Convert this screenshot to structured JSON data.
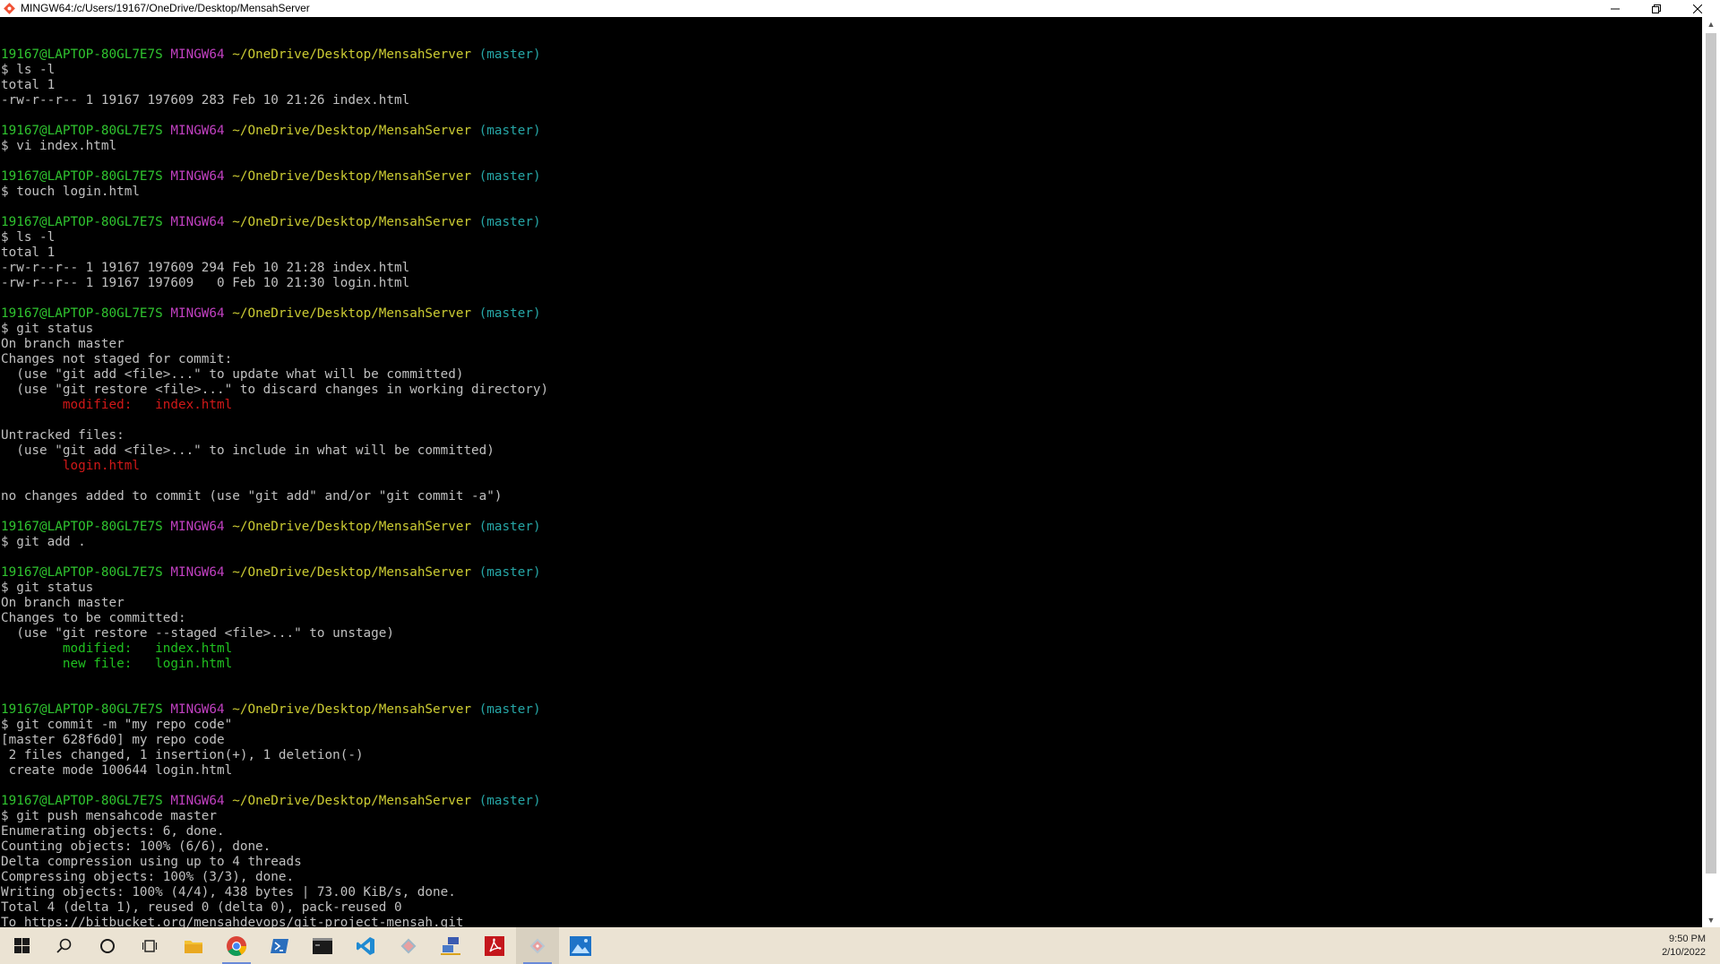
{
  "window": {
    "title": "MINGW64:/c/Users/19167/OneDrive/Desktop/MensahServer",
    "buttons": {
      "minimize": "minimize-icon",
      "restore": "restore-icon",
      "close": "close-icon"
    }
  },
  "colors": {
    "user_host": "#2fc42f",
    "shell": "#c040c0",
    "path": "#cccc33",
    "branch": "#26a6a6",
    "unstaged": "#d01818",
    "staged": "#20c020",
    "text": "#c0c0c0",
    "background": "#000000",
    "taskbar": "#ebe3d3"
  },
  "terminal": {
    "lines": [
      [],
      [
        {
          "t": "19167@LAPTOP-80GL7E7S",
          "c": "green"
        },
        {
          "t": " "
        },
        {
          "t": "MINGW64",
          "c": "magenta"
        },
        {
          "t": " "
        },
        {
          "t": "~/OneDrive/Desktop/MensahServer",
          "c": "yellow"
        },
        {
          "t": " "
        },
        {
          "t": "(master)",
          "c": "cyan"
        }
      ],
      [
        {
          "t": "$ ls -l"
        }
      ],
      [
        {
          "t": "total 1"
        }
      ],
      [
        {
          "t": "-rw-r--r-- 1 19167 197609 283 Feb 10 21:26 index.html"
        }
      ],
      [],
      [
        {
          "t": "19167@LAPTOP-80GL7E7S",
          "c": "green"
        },
        {
          "t": " "
        },
        {
          "t": "MINGW64",
          "c": "magenta"
        },
        {
          "t": " "
        },
        {
          "t": "~/OneDrive/Desktop/MensahServer",
          "c": "yellow"
        },
        {
          "t": " "
        },
        {
          "t": "(master)",
          "c": "cyan"
        }
      ],
      [
        {
          "t": "$ vi index.html"
        }
      ],
      [],
      [
        {
          "t": "19167@LAPTOP-80GL7E7S",
          "c": "green"
        },
        {
          "t": " "
        },
        {
          "t": "MINGW64",
          "c": "magenta"
        },
        {
          "t": " "
        },
        {
          "t": "~/OneDrive/Desktop/MensahServer",
          "c": "yellow"
        },
        {
          "t": " "
        },
        {
          "t": "(master)",
          "c": "cyan"
        }
      ],
      [
        {
          "t": "$ touch login.html"
        }
      ],
      [],
      [
        {
          "t": "19167@LAPTOP-80GL7E7S",
          "c": "green"
        },
        {
          "t": " "
        },
        {
          "t": "MINGW64",
          "c": "magenta"
        },
        {
          "t": " "
        },
        {
          "t": "~/OneDrive/Desktop/MensahServer",
          "c": "yellow"
        },
        {
          "t": " "
        },
        {
          "t": "(master)",
          "c": "cyan"
        }
      ],
      [
        {
          "t": "$ ls -l"
        }
      ],
      [
        {
          "t": "total 1"
        }
      ],
      [
        {
          "t": "-rw-r--r-- 1 19167 197609 294 Feb 10 21:28 index.html"
        }
      ],
      [
        {
          "t": "-rw-r--r-- 1 19167 197609   0 Feb 10 21:30 login.html"
        }
      ],
      [],
      [
        {
          "t": "19167@LAPTOP-80GL7E7S",
          "c": "green"
        },
        {
          "t": " "
        },
        {
          "t": "MINGW64",
          "c": "magenta"
        },
        {
          "t": " "
        },
        {
          "t": "~/OneDrive/Desktop/MensahServer",
          "c": "yellow"
        },
        {
          "t": " "
        },
        {
          "t": "(master)",
          "c": "cyan"
        }
      ],
      [
        {
          "t": "$ git status"
        }
      ],
      [
        {
          "t": "On branch master"
        }
      ],
      [
        {
          "t": "Changes not staged for commit:"
        }
      ],
      [
        {
          "t": "  (use \"git add <file>...\" to update what will be committed)"
        }
      ],
      [
        {
          "t": "  (use \"git restore <file>...\" to discard changes in working directory)"
        }
      ],
      [
        {
          "t": "        "
        },
        {
          "t": "modified:   index.html",
          "c": "red"
        }
      ],
      [],
      [
        {
          "t": "Untracked files:"
        }
      ],
      [
        {
          "t": "  (use \"git add <file>...\" to include in what will be committed)"
        }
      ],
      [
        {
          "t": "        "
        },
        {
          "t": "login.html",
          "c": "red"
        }
      ],
      [],
      [
        {
          "t": "no changes added to commit (use \"git add\" and/or \"git commit -a\")"
        }
      ],
      [],
      [
        {
          "t": "19167@LAPTOP-80GL7E7S",
          "c": "green"
        },
        {
          "t": " "
        },
        {
          "t": "MINGW64",
          "c": "magenta"
        },
        {
          "t": " "
        },
        {
          "t": "~/OneDrive/Desktop/MensahServer",
          "c": "yellow"
        },
        {
          "t": " "
        },
        {
          "t": "(master)",
          "c": "cyan"
        }
      ],
      [
        {
          "t": "$ git add ."
        }
      ],
      [],
      [
        {
          "t": "19167@LAPTOP-80GL7E7S",
          "c": "green"
        },
        {
          "t": " "
        },
        {
          "t": "MINGW64",
          "c": "magenta"
        },
        {
          "t": " "
        },
        {
          "t": "~/OneDrive/Desktop/MensahServer",
          "c": "yellow"
        },
        {
          "t": " "
        },
        {
          "t": "(master)",
          "c": "cyan"
        }
      ],
      [
        {
          "t": "$ git status"
        }
      ],
      [
        {
          "t": "On branch master"
        }
      ],
      [
        {
          "t": "Changes to be committed:"
        }
      ],
      [
        {
          "t": "  (use \"git restore --staged <file>...\" to unstage)"
        }
      ],
      [
        {
          "t": "        "
        },
        {
          "t": "modified:   index.html",
          "c": "stgreen"
        }
      ],
      [
        {
          "t": "        "
        },
        {
          "t": "new file:   login.html",
          "c": "stgreen"
        }
      ],
      [],
      [],
      [
        {
          "t": "19167@LAPTOP-80GL7E7S",
          "c": "green"
        },
        {
          "t": " "
        },
        {
          "t": "MINGW64",
          "c": "magenta"
        },
        {
          "t": " "
        },
        {
          "t": "~/OneDrive/Desktop/MensahServer",
          "c": "yellow"
        },
        {
          "t": " "
        },
        {
          "t": "(master)",
          "c": "cyan"
        }
      ],
      [
        {
          "t": "$ git commit -m \"my repo code\""
        }
      ],
      [
        {
          "t": "[master 628f6d0] my repo code"
        }
      ],
      [
        {
          "t": " 2 files changed, 1 insertion(+), 1 deletion(-)"
        }
      ],
      [
        {
          "t": " create mode 100644 login.html"
        }
      ],
      [],
      [
        {
          "t": "19167@LAPTOP-80GL7E7S",
          "c": "green"
        },
        {
          "t": " "
        },
        {
          "t": "MINGW64",
          "c": "magenta"
        },
        {
          "t": " "
        },
        {
          "t": "~/OneDrive/Desktop/MensahServer",
          "c": "yellow"
        },
        {
          "t": " "
        },
        {
          "t": "(master)",
          "c": "cyan"
        }
      ],
      [
        {
          "t": "$ git push mensahcode master"
        }
      ],
      [
        {
          "t": "Enumerating objects: 6, done."
        }
      ],
      [
        {
          "t": "Counting objects: 100% (6/6), done."
        }
      ],
      [
        {
          "t": "Delta compression using up to 4 threads"
        }
      ],
      [
        {
          "t": "Compressing objects: 100% (3/3), done."
        }
      ],
      [
        {
          "t": "Writing objects: 100% (4/4), 438 bytes | 73.00 KiB/s, done."
        }
      ],
      [
        {
          "t": "Total 4 (delta 1), reused 0 (delta 0), pack-reused 0"
        }
      ],
      [
        {
          "t": "To https://bitbucket.org/mensahdevops/git-project-mensah.git"
        }
      ]
    ]
  },
  "taskbar": {
    "items": [
      {
        "name": "start-button",
        "icon": "windows-logo-icon"
      },
      {
        "name": "search-button",
        "icon": "search-icon"
      },
      {
        "name": "cortana-button",
        "icon": "cortana-circle-icon"
      },
      {
        "name": "task-view-button",
        "icon": "task-view-icon"
      },
      {
        "name": "file-explorer-button",
        "icon": "folder-icon"
      },
      {
        "name": "chrome-button",
        "icon": "chrome-icon"
      },
      {
        "name": "powershell-button",
        "icon": "powershell-icon"
      },
      {
        "name": "terminal-button",
        "icon": "terminal-icon"
      },
      {
        "name": "vscode-button",
        "icon": "vscode-icon"
      },
      {
        "name": "git-gui-button",
        "icon": "git-diamond-icon"
      },
      {
        "name": "network-app-button",
        "icon": "network-icon"
      },
      {
        "name": "acrobat-button",
        "icon": "acrobat-icon"
      },
      {
        "name": "git-bash-button",
        "icon": "git-bash-icon"
      },
      {
        "name": "photos-button",
        "icon": "photos-icon"
      }
    ],
    "clock": {
      "time": "9:50 PM",
      "date": "2/10/2022"
    }
  }
}
